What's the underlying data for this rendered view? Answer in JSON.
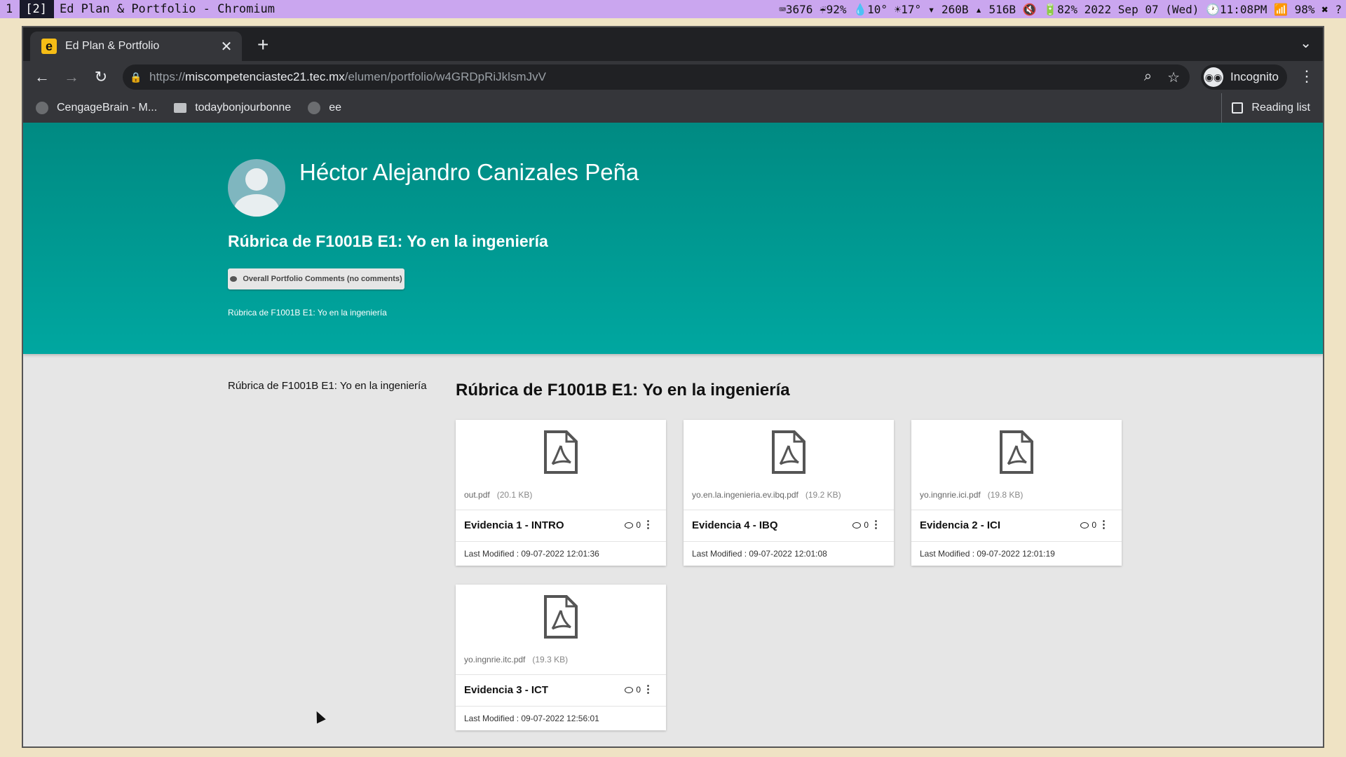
{
  "system_bar": {
    "workspace_1": "1",
    "workspace_2": "[2]",
    "window_title": "Ed Plan & Portfolio - Chromium",
    "status": "⌨3676 ☔92% 💧10° ☀17° ▾ 260B ▴ 516B 🔇 🔋82% 2022 Sep 07 (Wed) 🕐11:08PM 📶 98% ✖ ?"
  },
  "browser": {
    "tab_title": "Ed Plan & Portfolio",
    "tab_favicon": "e",
    "url_scheme": "https://",
    "url_host": "miscompetenciastec21.tec.mx",
    "url_path": "/elumen/portfolio/w4GRDpRiJklsmJvV",
    "profile_label": "Incognito",
    "bookmarks": [
      "CengageBrain - M...",
      "todaybonjourbonne",
      "ee"
    ],
    "reading_list": "Reading list"
  },
  "portfolio": {
    "student_name": "Héctor Alejandro Canizales Peña",
    "title": "Rúbrica de F1001B E1: Yo en la ingeniería",
    "comments_button": "Overall Portfolio Comments (no comments)",
    "breadcrumb": "Rúbrica de F1001B E1: Yo en la ingeniería",
    "side_nav_item": "Rúbrica de F1001B E1: Yo en la ingeniería",
    "section_title": "Rúbrica de F1001B E1: Yo en la ingeniería"
  },
  "cards": [
    {
      "file": "out.pdf",
      "size": "(20.1 KB)",
      "title": "Evidencia 1 - INTRO",
      "comments": "0",
      "modified": "Last Modified : 09-07-2022 12:01:36"
    },
    {
      "file": "yo.en.la.ingenieria.ev.ibq.pdf",
      "size": "(19.2 KB)",
      "title": "Evidencia 4 - IBQ",
      "comments": "0",
      "modified": "Last Modified : 09-07-2022 12:01:08"
    },
    {
      "file": "yo.ingnrie.ici.pdf",
      "size": "(19.8 KB)",
      "title": "Evidencia 2 - ICI",
      "comments": "0",
      "modified": "Last Modified : 09-07-2022 12:01:19"
    },
    {
      "file": "yo.ingnrie.itc.pdf",
      "size": "(19.3 KB)",
      "title": "Evidencia 3 - ICT",
      "comments": "0",
      "modified": "Last Modified : 09-07-2022 12:56:01"
    }
  ],
  "colors": {
    "hero_top": "#008a82",
    "hero_bottom": "#00a7a0",
    "page_bg": "#e6e6e6",
    "sysbar_bg": "#caa6ef"
  }
}
